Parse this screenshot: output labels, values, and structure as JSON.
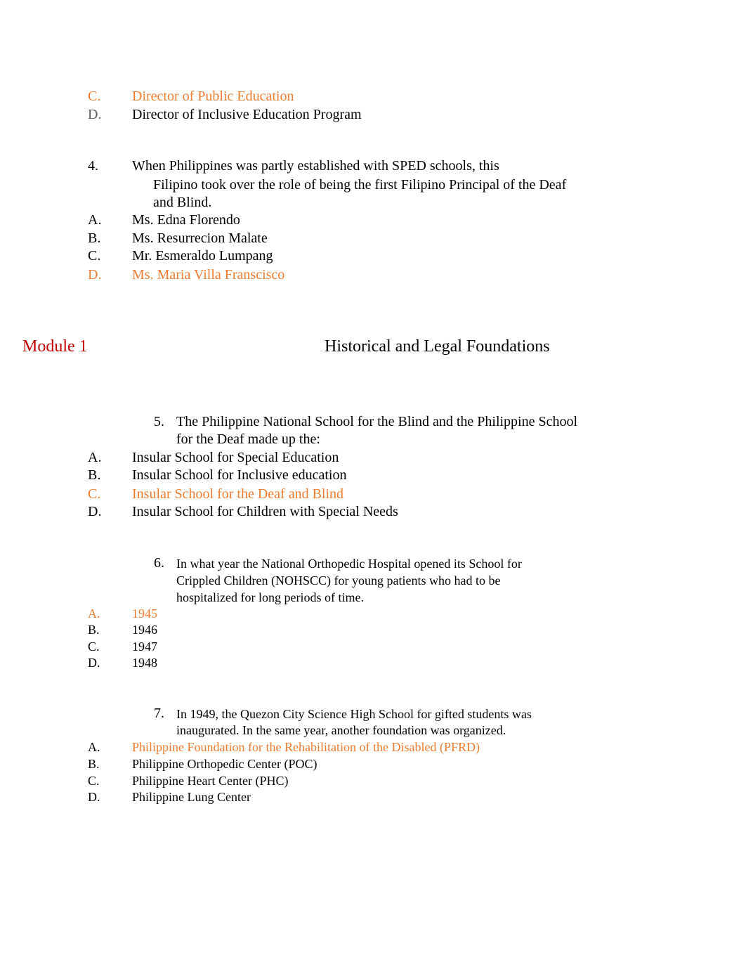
{
  "colors": {
    "answer_highlight": "#ed7d31",
    "module_label": "#c00000",
    "default_text": "#000000",
    "muted_label": "#595959"
  },
  "q3_tail": {
    "options": [
      {
        "letter": "C.",
        "text": "Director of Public Education",
        "highlighted": true
      },
      {
        "letter": "D.",
        "text": "Director of Inclusive Education Program",
        "highlighted": false
      }
    ]
  },
  "q4": {
    "number": "4.",
    "lines": [
      "When Philippines was partly established with SPED schools, this",
      "Filipino took over the role of being the first Filipino Principal of the Deaf",
      "and Blind."
    ],
    "options": [
      {
        "letter": "A.",
        "text": "Ms. Edna Florendo",
        "highlighted": false
      },
      {
        "letter": "B.",
        "text": "Ms. Resurrecion Malate",
        "highlighted": false
      },
      {
        "letter": "C.",
        "text": "Mr. Esmeraldo Lumpang",
        "highlighted": false
      },
      {
        "letter": "D.",
        "text": "Ms. Maria Villa Franscisco",
        "highlighted": true
      }
    ]
  },
  "section": {
    "module": "Module 1",
    "title": "Historical and Legal Foundations"
  },
  "q5": {
    "number": "5.",
    "lines": [
      "The Philippine National School for the Blind and the Philippine School",
      "for the Deaf made up the:"
    ],
    "options": [
      {
        "letter": "A.",
        "text": "Insular School for Special Education",
        "highlighted": false
      },
      {
        "letter": "B.",
        "text": "Insular School for Inclusive education",
        "highlighted": false
      },
      {
        "letter": "C.",
        "text": "Insular School for the Deaf and Blind",
        "highlighted": true
      },
      {
        "letter": "D.",
        "text": "Insular School for Children with Special Needs",
        "highlighted": false
      }
    ]
  },
  "q6": {
    "number": "6.",
    "lines": [
      "In what year the National Orthopedic Hospital opened its School for",
      "Crippled Children (NOHSCC) for young patients who had to be",
      "hospitalized for long periods of time."
    ],
    "options": [
      {
        "letter": "A.",
        "text": "1945",
        "highlighted": true
      },
      {
        "letter": "B.",
        "text": "1946",
        "highlighted": false
      },
      {
        "letter": "C.",
        "text": "1947",
        "highlighted": false
      },
      {
        "letter": "D.",
        "text": "1948",
        "highlighted": false
      }
    ]
  },
  "q7": {
    "number": "7.",
    "lines": [
      "In 1949, the Quezon City Science High School for gifted students was",
      "inaugurated. In the same year, another foundation was organized."
    ],
    "options": [
      {
        "letter": "A.",
        "text": "Philippine Foundation for the Rehabilitation of the Disabled (PFRD)",
        "highlighted": true
      },
      {
        "letter": "B.",
        "text": "Philippine Orthopedic Center (POC)",
        "highlighted": false
      },
      {
        "letter": "C.",
        "text": "Philippine Heart Center (PHC)",
        "highlighted": false
      },
      {
        "letter": "D.",
        "text": "Philippine Lung Center",
        "highlighted": false
      }
    ]
  }
}
